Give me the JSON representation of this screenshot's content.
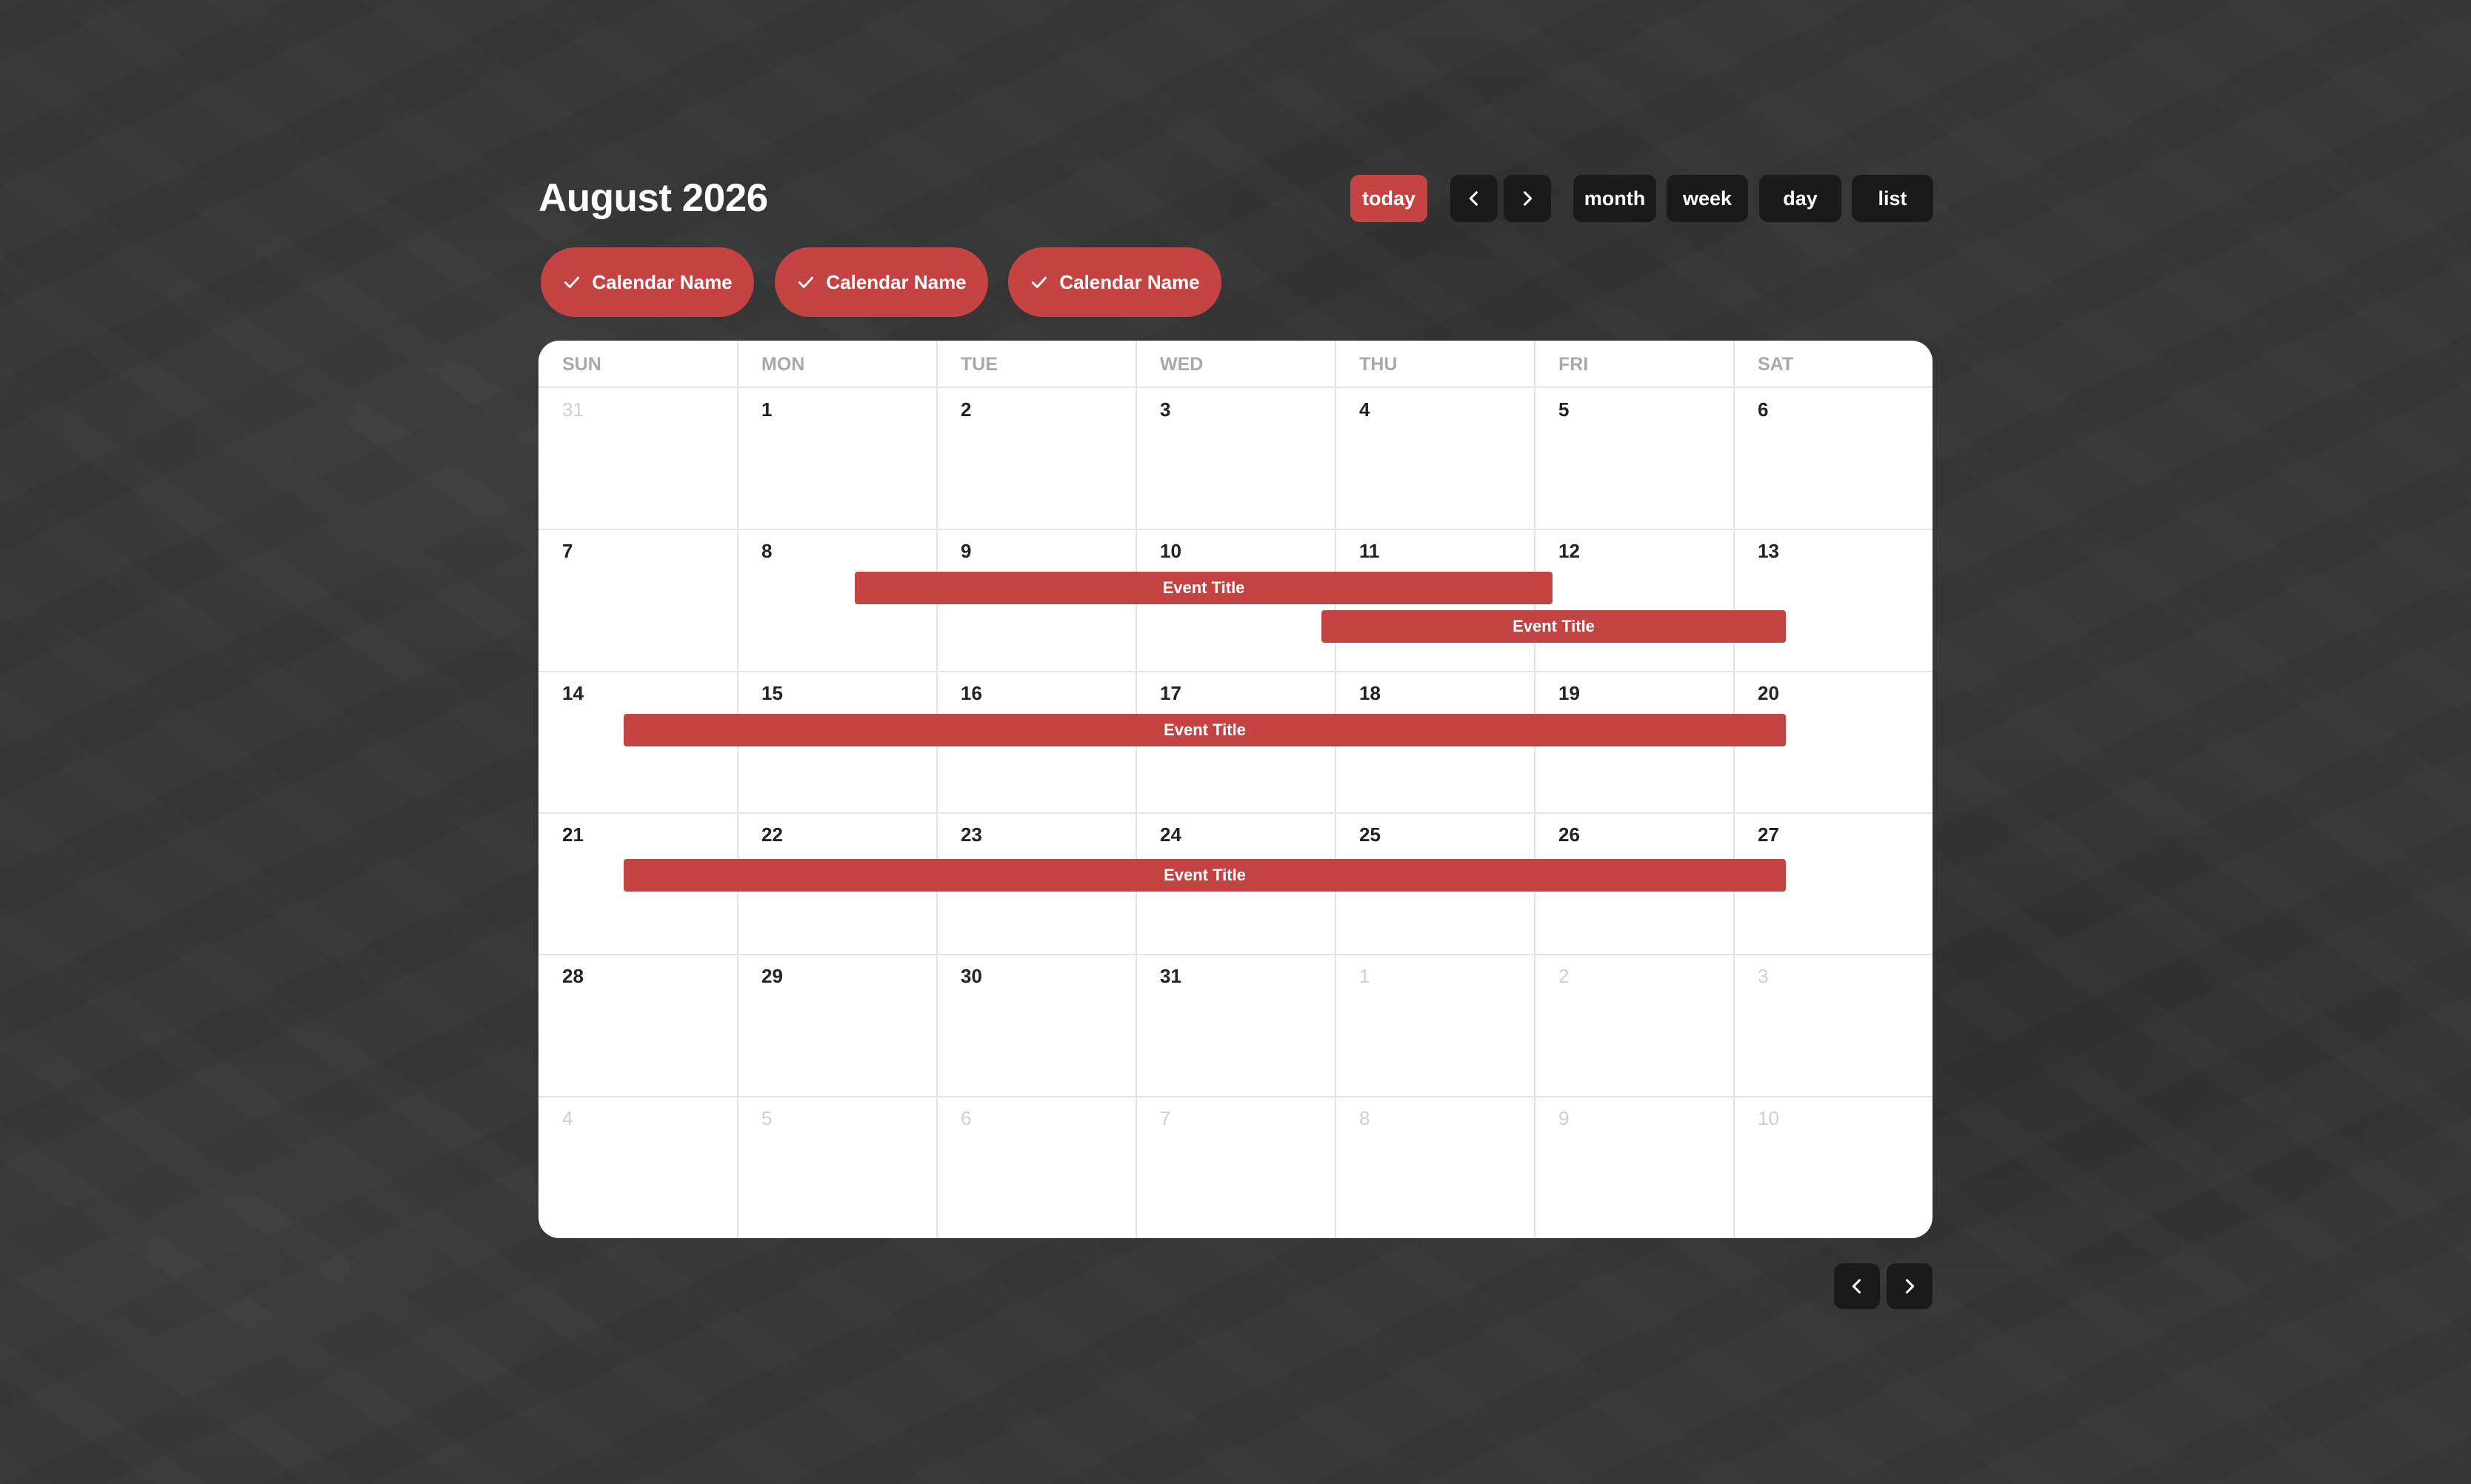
{
  "header": {
    "title": "August 2026"
  },
  "toolbar": {
    "today_label": "today",
    "prev_icon": "chevron-left-icon",
    "next_icon": "chevron-right-icon",
    "views": [
      "month",
      "week",
      "day",
      "list"
    ]
  },
  "calendars": [
    {
      "label": "Calendar Name",
      "checked": true
    },
    {
      "label": "Calendar Name",
      "checked": true
    },
    {
      "label": "Calendar Name",
      "checked": true
    }
  ],
  "weekdays": [
    "SUN",
    "MON",
    "TUE",
    "WED",
    "THU",
    "FRI",
    "SAT"
  ],
  "weeks": [
    [
      {
        "n": "31",
        "muted": true
      },
      {
        "n": "1"
      },
      {
        "n": "2"
      },
      {
        "n": "3"
      },
      {
        "n": "4"
      },
      {
        "n": "5"
      },
      {
        "n": "6"
      }
    ],
    [
      {
        "n": "7"
      },
      {
        "n": "8"
      },
      {
        "n": "9"
      },
      {
        "n": "10"
      },
      {
        "n": "11"
      },
      {
        "n": "12"
      },
      {
        "n": "13"
      }
    ],
    [
      {
        "n": "14"
      },
      {
        "n": "15"
      },
      {
        "n": "16"
      },
      {
        "n": "17"
      },
      {
        "n": "18"
      },
      {
        "n": "19"
      },
      {
        "n": "20"
      }
    ],
    [
      {
        "n": "21"
      },
      {
        "n": "22"
      },
      {
        "n": "23"
      },
      {
        "n": "24"
      },
      {
        "n": "25"
      },
      {
        "n": "26"
      },
      {
        "n": "27"
      }
    ],
    [
      {
        "n": "28"
      },
      {
        "n": "29"
      },
      {
        "n": "30"
      },
      {
        "n": "31"
      },
      {
        "n": "1",
        "muted": true
      },
      {
        "n": "2",
        "muted": true
      },
      {
        "n": "3",
        "muted": true
      }
    ],
    [
      {
        "n": "4",
        "muted": true
      },
      {
        "n": "5",
        "muted": true
      },
      {
        "n": "6",
        "muted": true
      },
      {
        "n": "7",
        "muted": true
      },
      {
        "n": "8",
        "muted": true
      },
      {
        "n": "9",
        "muted": true
      },
      {
        "n": "10",
        "muted": true
      }
    ]
  ],
  "events": [
    {
      "title": "Event Title",
      "week": 1,
      "start_day": "9",
      "end_day": "12"
    },
    {
      "title": "Event Title",
      "week": 1,
      "start_day": "11",
      "end_day": "13"
    },
    {
      "title": "Event Title",
      "week": 2,
      "start_day": "14",
      "end_day": "20"
    },
    {
      "title": "Event Title",
      "week": 3,
      "start_day": "21",
      "end_day": "27"
    }
  ],
  "footer": {
    "prev_icon": "chevron-left-icon",
    "next_icon": "chevron-right-icon"
  },
  "colors": {
    "accent": "#c44343",
    "button_dark": "#1a1a1a",
    "background": "#363636",
    "grid_line": "#e4e4e4",
    "muted_text": "#d0d0d0",
    "weekday_text": "#a9a9a9"
  }
}
